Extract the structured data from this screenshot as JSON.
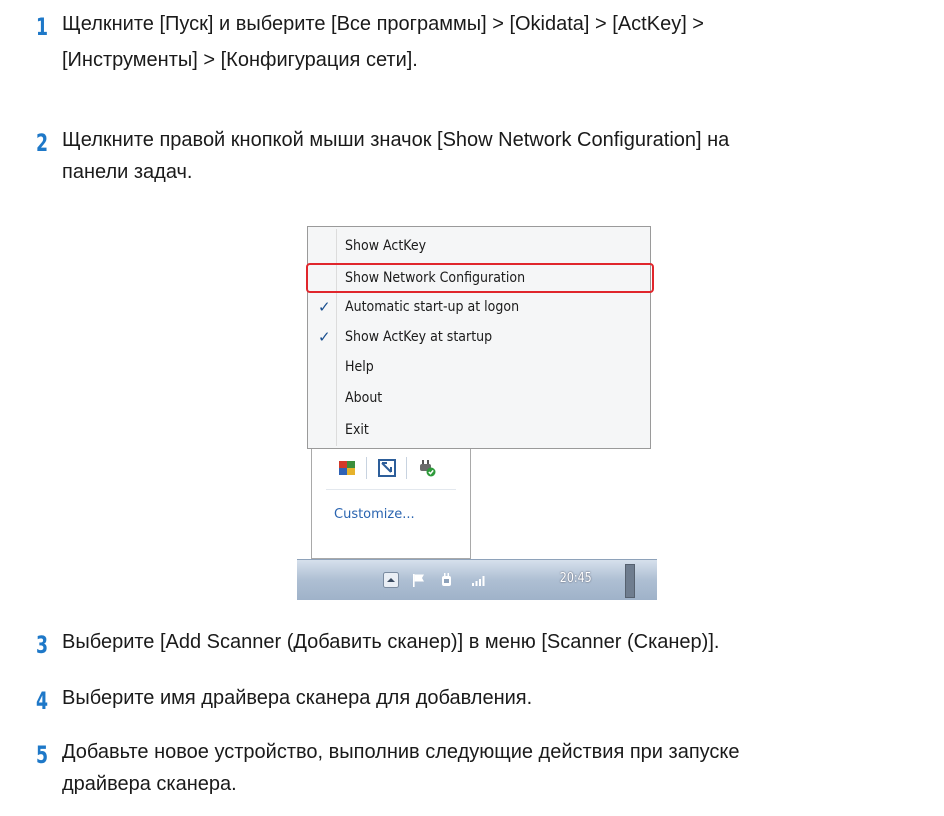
{
  "steps": [
    {
      "number": "1",
      "lines": [
        "Щелкните [Пуск] и выберите [Все программы] > [Okidata] > [ActKey] >",
        "[Инструменты] > [Конфигурация сети]."
      ]
    },
    {
      "number": "2",
      "lines": [
        "Щелкните правой кнопкой мыши значок [Show Network Configuration] на",
        "панели задач."
      ]
    },
    {
      "number": "3",
      "lines": [
        "Выберите [Add Scanner (Добавить сканер)] в меню [Scanner (Сканер)]."
      ]
    },
    {
      "number": "4",
      "lines": [
        "Выберите имя драйвера сканера для добавления."
      ]
    },
    {
      "number": "5",
      "lines": [
        "Добавьте новое устройство, выполнив следующие действия при запуске",
        "драйвера сканера."
      ]
    }
  ],
  "context_menu": {
    "items": [
      {
        "label": "Show ActKey",
        "checked": false
      },
      {
        "label": "Show Network Configuration",
        "checked": false,
        "highlighted": true
      },
      {
        "label": "Automatic start-up at logon",
        "checked": true
      },
      {
        "label": "Show ActKey at startup",
        "checked": true
      },
      {
        "label": "Help",
        "checked": false
      },
      {
        "label": "About",
        "checked": false
      },
      {
        "label": "Exit",
        "checked": false
      }
    ],
    "check_glyph": "✓",
    "highlight_color": "#e0262c"
  },
  "tray_popup": {
    "icons": [
      "actkey-app-icon",
      "network-config-icon",
      "plug-check-icon"
    ],
    "customize_label": "Customize..."
  },
  "taskbar": {
    "icons": [
      "show-hidden-icons-arrow",
      "flag-icon",
      "power-icon",
      "signal-icon"
    ],
    "clock": "20:45"
  },
  "colors": {
    "step_number": "#1e78c8",
    "link": "#2a64b0"
  }
}
